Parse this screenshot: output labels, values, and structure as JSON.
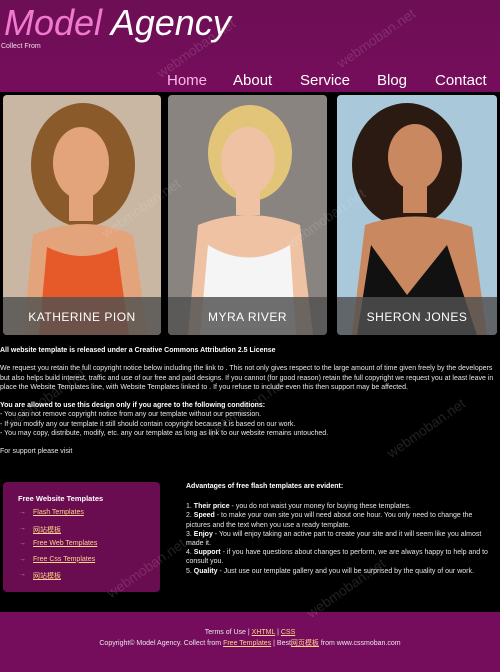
{
  "header": {
    "logo_model": "Model",
    "logo_agency": " Agency",
    "collect": "Collect From"
  },
  "nav": {
    "items": [
      {
        "label": "Home",
        "active": true
      },
      {
        "label": "About"
      },
      {
        "label": "Service"
      },
      {
        "label": "Blog"
      },
      {
        "label": "Contact"
      }
    ]
  },
  "models": [
    {
      "name": "KATHERINE PION",
      "colors": {
        "bg": "#c9b6a3",
        "hair": "#8b5a2b",
        "skin": "#e3a47c",
        "cloth": "#e65a2a"
      }
    },
    {
      "name": "MYRA RIVER",
      "colors": {
        "bg": "#8a8480",
        "hair": "#e3c57a",
        "skin": "#efc2a4",
        "cloth": "#f5f5f5"
      }
    },
    {
      "name": "SHERON JONES",
      "colors": {
        "bg": "#a9c8da",
        "hair": "#2b1a12",
        "skin": "#c98860",
        "cloth": "#111111"
      }
    }
  ],
  "license": {
    "heading": "All website template is released under a Creative Commons Attribution 2.5 License",
    "para": "We request you retain the full copyright notice below including the link to . This not only gives respect to the large amount of time given freely by the developers but also helps build interest, traffic and use of our free and paid designs. If you cannot (for good reason) retain the full copyright we request you at least leave in place the Website Templates line, with Website Templates linked to . If you refuse to include even this then support may be affected.",
    "rules_heading": "You are allowed to use this design only if you agree to the following conditions:",
    "rules": [
      "- You can not remove copyright notice from any our template without our permission.",
      "- If you modify any our template it still should contain copyright because it is based on our work.",
      "- You may copy, distribute, modify, etc. any our template as long as link to our website remains untouched."
    ],
    "support": "For support please visit"
  },
  "sidebar": {
    "title": "Free Website Templates",
    "items": [
      "Flash Templates",
      "网站模板",
      "Free Web Templates",
      "Free Css Templates",
      "网站模板"
    ]
  },
  "advantages": {
    "heading": "Advantages of free flash templates are evident:",
    "items": [
      {
        "num": "1.",
        "term": "Their price",
        "text": " - you do not waist your money for buying these templates."
      },
      {
        "num": "2.",
        "term": "Speed",
        "text": " - to make your own site you will need about one hour. You only need to change the pictures and the text when you use a ready template."
      },
      {
        "num": "3.",
        "term": "Enjoy",
        "text": " - You will enjoy taking an active part to create your site and it will seem like you almost made it."
      },
      {
        "num": "4.",
        "term": "Support",
        "text": " - if you have questions about changes to perform, we are always happy to help and to consult you."
      },
      {
        "num": "5.",
        "term": "Quality",
        "text": " - Just use our template gallery and you will be surprised by the quality of our work."
      }
    ]
  },
  "footer": {
    "terms": "Terms of Use",
    "sep": " | ",
    "xhtml": "XHTML",
    "css": "CSS",
    "copyright": "Copyright© Model Agency. Collect from ",
    "free_templates": "Free Templates",
    "best": " | Best",
    "best_link": "网页模板",
    "from": " from www.cssmoban.com"
  },
  "watermark": "webmoban.net",
  "colors": {
    "header_bg": "#760d5c",
    "accent_pink": "#f17ad0",
    "link_orange": "#ffd38a"
  }
}
